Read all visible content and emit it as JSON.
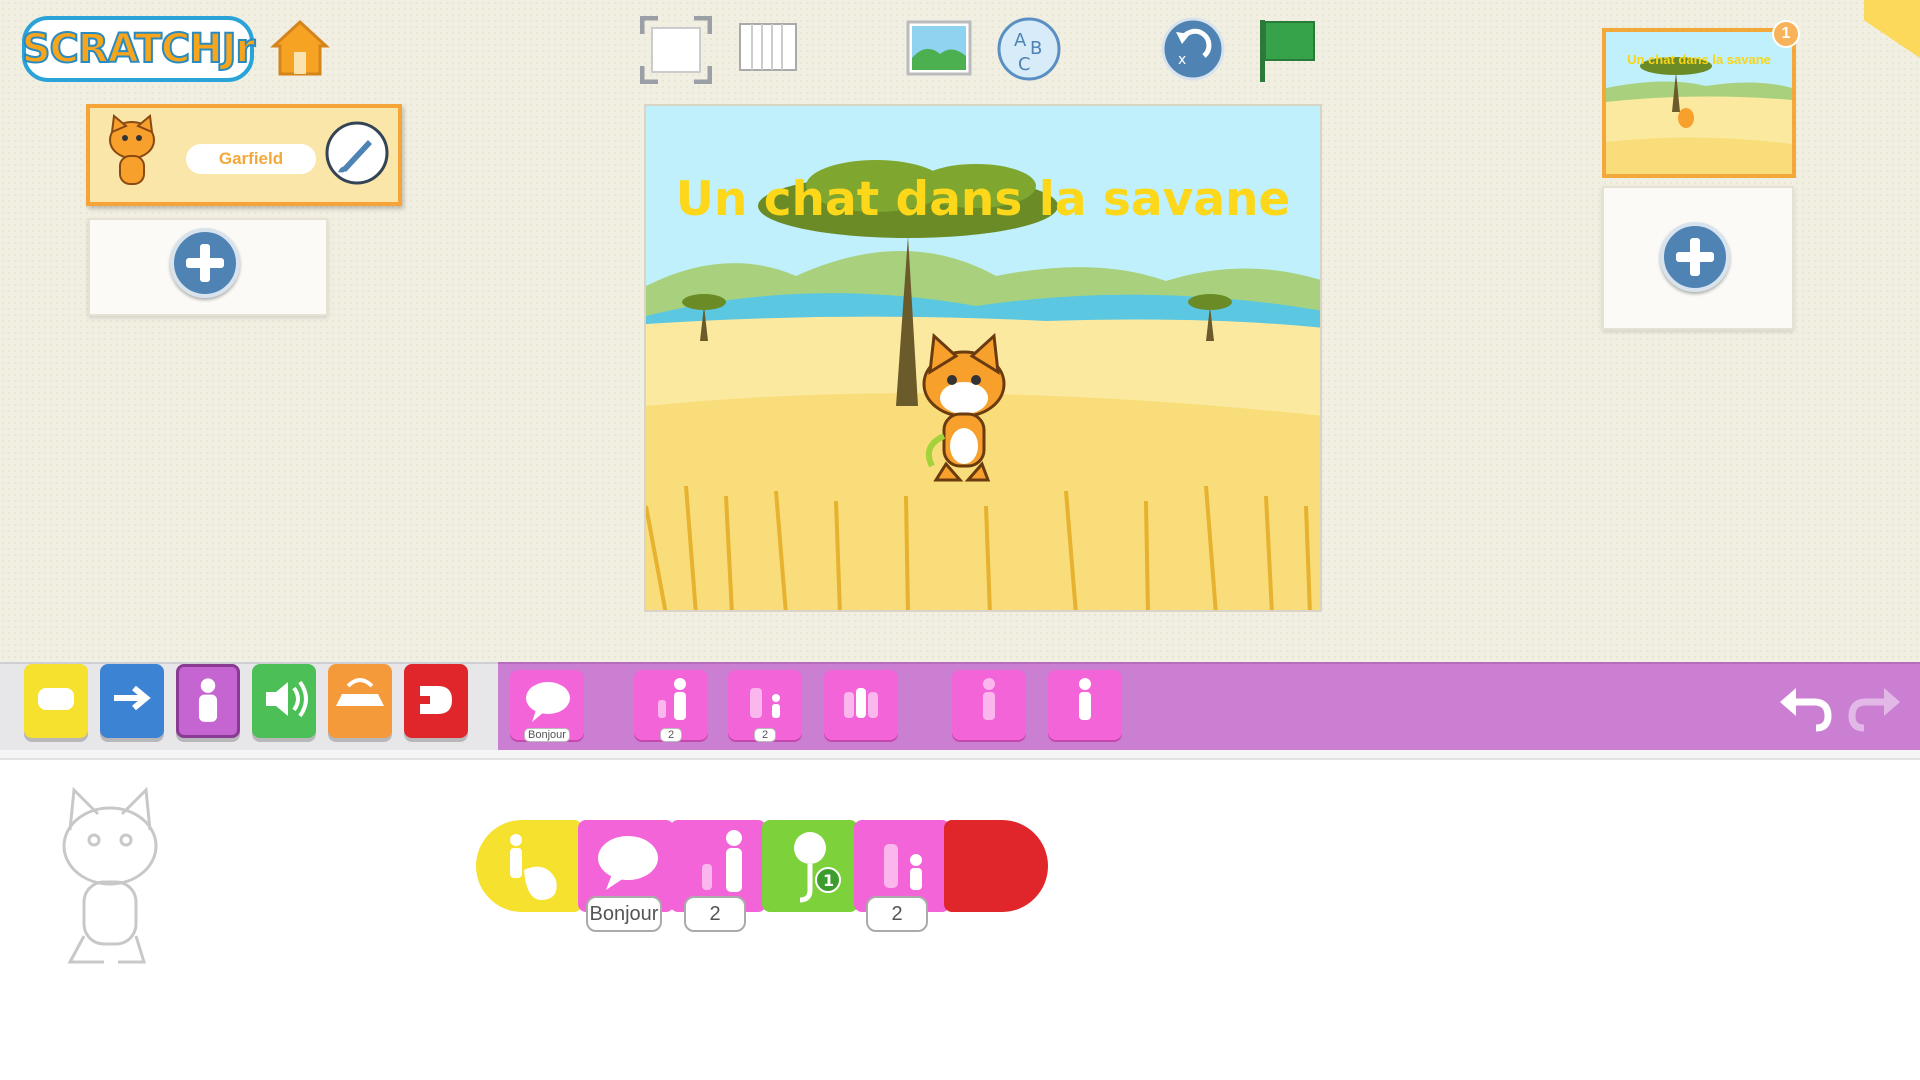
{
  "app": {
    "logo_text": "SCRATCHJr"
  },
  "toolbar": {
    "home": "home-icon",
    "fullscreen": "fullscreen-icon",
    "grid": "grid-icon",
    "background": "background-icon",
    "text": "text-abc-icon",
    "reset": "reset-icon",
    "green_flag": "green-flag-icon"
  },
  "sprites": [
    {
      "name": "Garfield",
      "selected": true
    }
  ],
  "stage": {
    "title": "Un chat dans la savane"
  },
  "pages": [
    {
      "number": "1",
      "title": "Un chat dans la savane"
    }
  ],
  "categories": [
    {
      "name": "triggering",
      "color": "#f6e12e"
    },
    {
      "name": "motion",
      "color": "#3d83d3"
    },
    {
      "name": "looks",
      "color": "#c465d1"
    },
    {
      "name": "sound",
      "color": "#4cbf56"
    },
    {
      "name": "control",
      "color": "#f59a3a"
    },
    {
      "name": "end",
      "color": "#e0262b"
    }
  ],
  "palette": {
    "blocks": [
      {
        "name": "say",
        "label": "Bonjour"
      },
      {
        "name": "grow",
        "label": "2"
      },
      {
        "name": "shrink",
        "label": "2"
      },
      {
        "name": "reset-size",
        "label": ""
      },
      {
        "name": "hide",
        "label": ""
      },
      {
        "name": "show",
        "label": ""
      }
    ]
  },
  "script": {
    "blocks": [
      {
        "name": "start-on-tap",
        "color": "#f6e12e"
      },
      {
        "name": "say",
        "color": "#f364d8",
        "value": "Bonjour"
      },
      {
        "name": "grow",
        "color": "#f364d8",
        "value": "2"
      },
      {
        "name": "play-recorded-sound",
        "color": "#7dd23c",
        "value": "1"
      },
      {
        "name": "shrink",
        "color": "#f364d8",
        "value": "2"
      },
      {
        "name": "end",
        "color": "#e0262b"
      }
    ]
  }
}
